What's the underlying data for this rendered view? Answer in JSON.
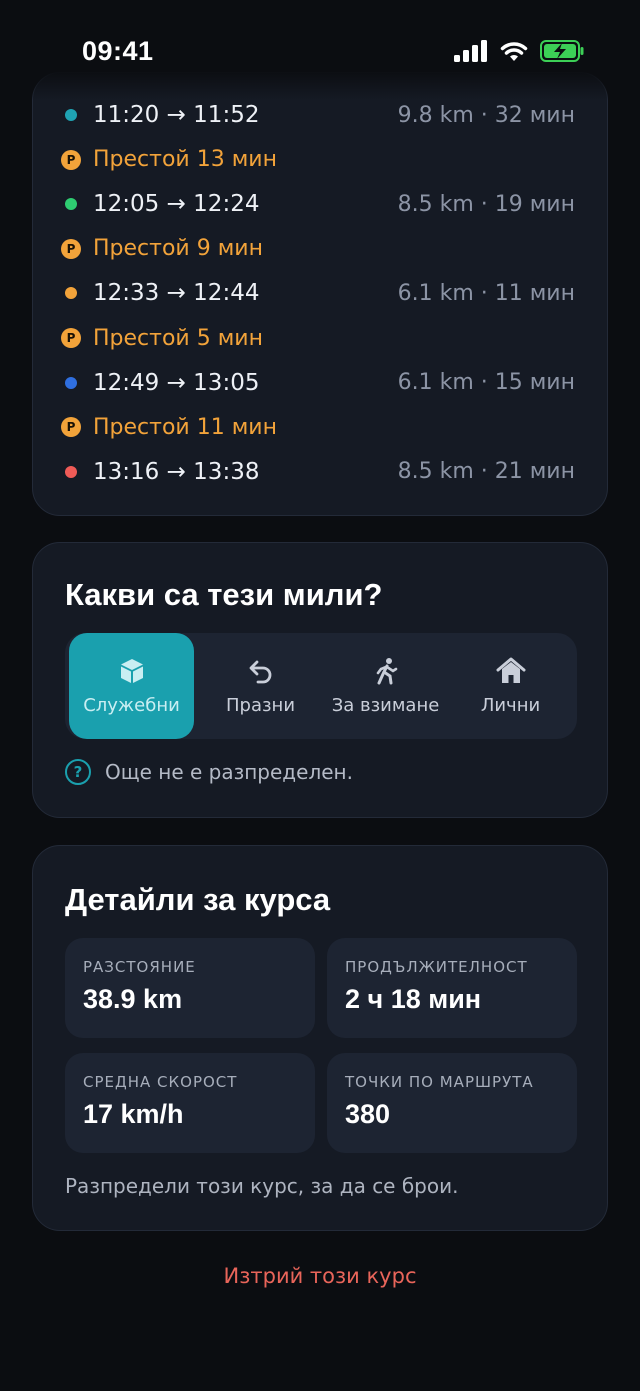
{
  "status_bar": {
    "time": "09:41"
  },
  "trips": [
    {
      "type": "trip",
      "color": "#1fa3b3",
      "time": "11:20 → 11:52",
      "meta": "9.8 km · 32 мин"
    },
    {
      "type": "stop",
      "badge": "P",
      "text": "Престой 13 мин"
    },
    {
      "type": "trip",
      "color": "#2ecc71",
      "time": "12:05 → 12:24",
      "meta": "8.5 km · 19 мин"
    },
    {
      "type": "stop",
      "badge": "P",
      "text": "Престой 9 мин"
    },
    {
      "type": "trip",
      "color": "#f2a33a",
      "time": "12:33 → 12:44",
      "meta": "6.1 km · 11 мин"
    },
    {
      "type": "stop",
      "badge": "P",
      "text": "Престой 5 мин"
    },
    {
      "type": "trip",
      "color": "#2f6fe0",
      "time": "12:49 → 13:05",
      "meta": "6.1 km · 15 мин"
    },
    {
      "type": "stop",
      "badge": "P",
      "text": "Престой 11 мин"
    },
    {
      "type": "trip",
      "color": "#ef5b57",
      "time": "13:16 → 13:38",
      "meta": "8.5 km · 21 мин"
    }
  ],
  "miles": {
    "title": "Какви са тези мили?",
    "options": [
      {
        "icon": "box-icon",
        "label": "Служебни",
        "selected": true
      },
      {
        "icon": "return-arrow-icon",
        "label": "Празни",
        "selected": false
      },
      {
        "icon": "walking-person-icon",
        "label": "За взимане",
        "selected": false
      },
      {
        "icon": "home-icon",
        "label": "Лични",
        "selected": false
      }
    ],
    "hint": "Още не е разпределен."
  },
  "details": {
    "title": "Детайли за курса",
    "stats": [
      {
        "label": "РАЗСТОЯНИЕ",
        "value": "38.9 km"
      },
      {
        "label": "ПРОДЪЛЖИТЕЛНОСТ",
        "value": "2 ч 18 мин"
      },
      {
        "label": "СРЕДНА СКОРОСТ",
        "value": "17 km/h"
      },
      {
        "label": "ТОЧКИ ПО МАРШРУТА",
        "value": "380"
      }
    ],
    "note": "Разпредели този курс, за да се брои."
  },
  "delete_label": "Изтрий този курс",
  "colors": {
    "accent": "#1aa0ae",
    "stop": "#f2a33a",
    "danger": "#e9655a"
  }
}
